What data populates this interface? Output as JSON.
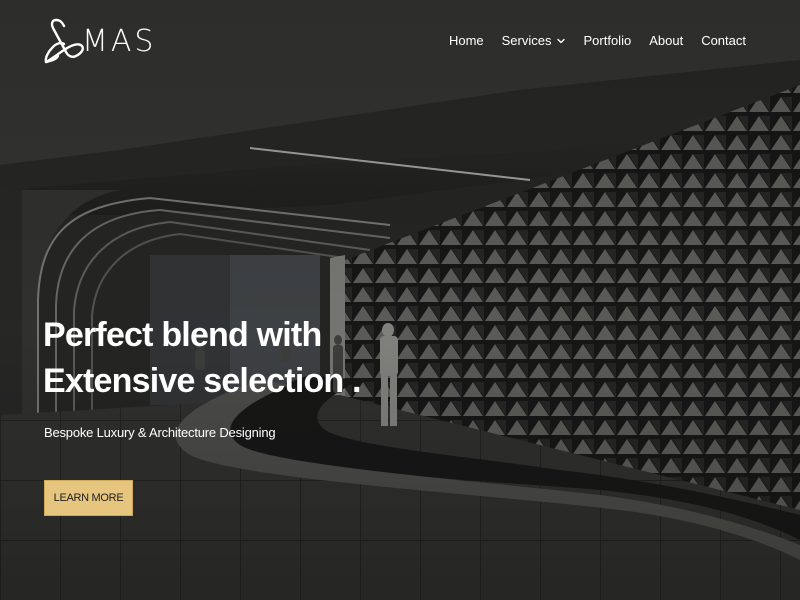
{
  "brand": {
    "logo_text": "MAS",
    "logo_icon": "mas-monogram-icon"
  },
  "nav": {
    "items": [
      {
        "label": "Home"
      },
      {
        "label": "Services",
        "icon": "chevron-down-icon"
      },
      {
        "label": "Portfolio"
      },
      {
        "label": "About"
      },
      {
        "label": "Contact"
      }
    ]
  },
  "hero": {
    "headline_line1": "Perfect blend with",
    "headline_line2": "Extensive selection .",
    "subtitle": "Bespoke Luxury & Architecture Designing",
    "cta_label": "LEARN MORE",
    "background_image": "architectural-lobby-render"
  },
  "colors": {
    "accent": "#e6c57f",
    "text": "#ffffff",
    "overlay": "#2a2a28"
  }
}
